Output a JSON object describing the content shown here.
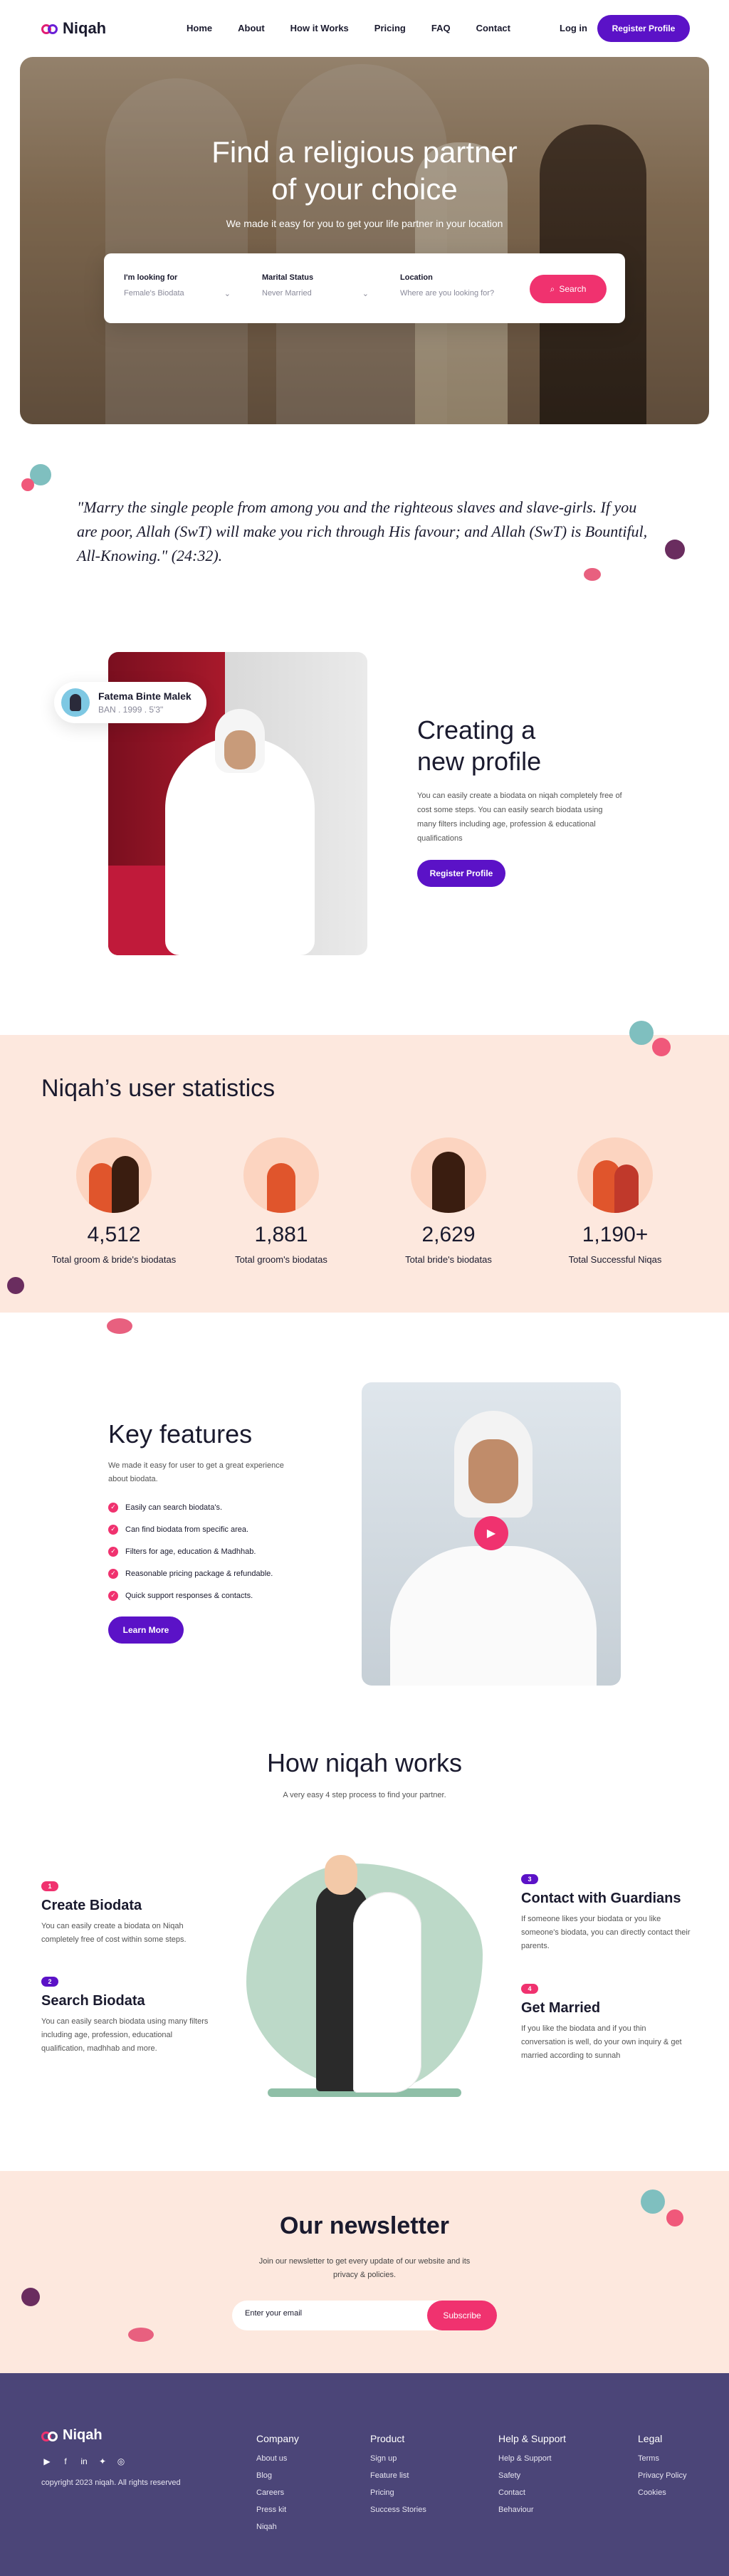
{
  "nav": {
    "logo": "Niqah",
    "links": [
      "Home",
      "About",
      "How it Works",
      "Pricing",
      "FAQ",
      "Contact"
    ],
    "login": "Log in",
    "register": "Register Profile"
  },
  "hero": {
    "title_line1": "Find a religious partner",
    "title_line2": "of your choice",
    "subtitle": "We made it easy for you to get your life partner in your location",
    "fields": [
      {
        "label": "I'm looking for",
        "value": "Female's Biodata"
      },
      {
        "label": "Marital Status",
        "value": "Never Married"
      },
      {
        "label": "Location",
        "placeholder": "Where are you looking for?"
      }
    ],
    "search_button": "Search"
  },
  "quote": "\"Marry the single people from among you and the righteous slaves and slave-girls. If you are poor, Allah (SwT) will make you rich through His favour; and Allah (SwT) is Bountiful, All-Knowing.\" (24:32).",
  "profile": {
    "card_name": "Fatema Binte Malek",
    "card_meta": "BAN . 1999 . 5'3\"",
    "title_line1": "Creating a",
    "title_line2": "new profile",
    "description": "You can easily create a biodata on niqah completely free of cost some steps. You can easily search biodata using many filters including age, profession & educational qualifications",
    "button": "Register Profile"
  },
  "stats": {
    "title": "Niqah’s user statistics",
    "items": [
      {
        "number": "4,512",
        "caption": "Total groom & bride's biodatas",
        "icon": "couple-icon"
      },
      {
        "number": "1,881",
        "caption": "Total groom's biodatas",
        "icon": "groom-icon"
      },
      {
        "number": "2,629",
        "caption": "Total bride's biodatas",
        "icon": "bride-icon"
      },
      {
        "number": "1,190+",
        "caption": "Total Successful Niqas",
        "icon": "married-couple-icon"
      }
    ]
  },
  "features": {
    "title": "Key features",
    "intro": "We made it easy for user to get a great experience about biodata.",
    "items": [
      "Easily can search biodata's.",
      "Can find biodata from specific area.",
      "Filters for age, education & Madhhab.",
      "Reasonable pricing package & refundable.",
      "Quick support responses & contacts."
    ],
    "button": "Learn More"
  },
  "how": {
    "title": "How niqah works",
    "subtitle": "A very easy 4 step process to find your partner.",
    "steps": [
      {
        "n": "1",
        "title": "Create Biodata",
        "text": "You can easily create a biodata on Niqah completely free of cost within some steps."
      },
      {
        "n": "2",
        "title": "Search Biodata",
        "text": "You can easily search biodata using many filters including age, profession, educational qualification, madhhab and more."
      },
      {
        "n": "3",
        "title": "Contact with Guardians",
        "text": "If someone likes your biodata or you like someone's biodata, you can directly contact their parents."
      },
      {
        "n": "4",
        "title": "Get Married",
        "text": "If you like the biodata and if you thin conversation is well, do your own inquiry & get married according to sunnah"
      }
    ],
    "colors": {
      "step1": "#f0326f",
      "step2": "#5b12c7",
      "step3": "#5b12c7",
      "step4": "#f0326f"
    }
  },
  "newsletter": {
    "title": "Our newsletter",
    "text": "Join our newsletter to get every update of our website and its privacy & policies.",
    "placeholder": "Enter your email",
    "button": "Subscribe"
  },
  "footer": {
    "logo": "Niqah",
    "copyright": "copyright 2023 niqah. All rights reserved",
    "socials": [
      "youtube-icon",
      "facebook-icon",
      "linkedin-icon",
      "twitter-icon",
      "instagram-icon"
    ],
    "columns": [
      {
        "title": "Company",
        "links": [
          "About us",
          "Blog",
          "Careers",
          "Press kit",
          "Niqah"
        ]
      },
      {
        "title": "Product",
        "links": [
          "Sign up",
          "Feature list",
          "Pricing",
          "Success Stories"
        ]
      },
      {
        "title": "Help & Support",
        "links": [
          "Help & Support",
          "Safety",
          "Contact",
          "Behaviour"
        ]
      },
      {
        "title": "Legal",
        "links": [
          "Terms",
          "Privacy Policy",
          "Cookies"
        ]
      }
    ]
  },
  "colors": {
    "primary": "#5b12c7",
    "accent": "#f0326f",
    "peach": "#fde8de",
    "footer": "#4b4578"
  }
}
